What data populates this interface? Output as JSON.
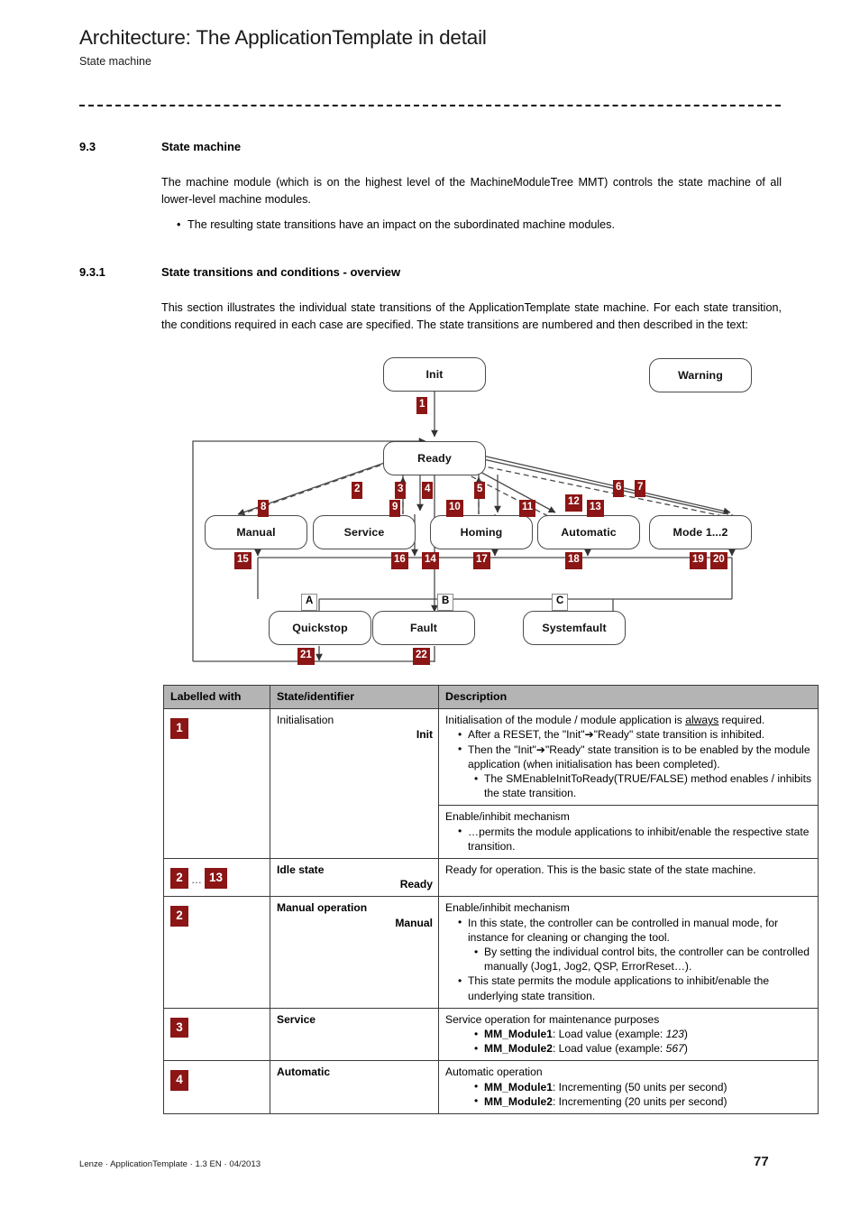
{
  "header": {
    "title": "Architecture: The ApplicationTemplate in detail",
    "subtitle": "State machine"
  },
  "sections": [
    {
      "number": "9.3",
      "title": "State machine",
      "paragraph": "The machine module (which is on the highest level of the MachineModuleTree MMT) controls the state machine of all lower-level machine modules.",
      "bullet": "The resulting state transitions have an impact on the subordinated machine modules."
    },
    {
      "number": "9.3.1",
      "title": "State transitions and conditions - overview",
      "paragraph": "This section illustrates the individual state transitions of the ApplicationTemplate state machine. For each state transition, the conditions required in each case are specified. The state transitions are numbered and then described in the text:"
    }
  ],
  "diagram": {
    "accent_color": "#8c1515",
    "nodes": {
      "init": "Init",
      "warning": "Warning",
      "ready": "Ready",
      "manual": "Manual",
      "service": "Service",
      "homing": "Homing",
      "automatic": "Automatic",
      "mode12": "Mode 1...2",
      "quickstop": "Quickstop",
      "fault": "Fault",
      "systemfault": "Systemfault"
    },
    "transition_tags": [
      "1",
      "2",
      "3",
      "4",
      "5",
      "6",
      "7",
      "8",
      "9",
      "10",
      "11",
      "12",
      "13",
      "14",
      "15",
      "16",
      "17",
      "18",
      "19",
      "20",
      "21",
      "22"
    ],
    "letter_tags": [
      "A",
      "B",
      "C"
    ]
  },
  "table": {
    "headers": [
      "Labelled with",
      "State/identifier",
      "Description"
    ],
    "rows": [
      {
        "tag": "1",
        "state": "Initialisation",
        "identifier": "Init",
        "desc_lead": "Initialisation of the module / module application is always required.",
        "desc_lead_underline": "always",
        "bullets": [
          {
            "level": 1,
            "text": "After a RESET, the \"Init\"➔\"Ready\" state transition is inhibited."
          },
          {
            "level": 1,
            "text": "Then the \"Init\"➔\"Ready\" state transition is to be enabled by the module application (when initialisation has been completed)."
          },
          {
            "level": 2,
            "text": "The SMEnableInitToReady(TRUE/FALSE) method enables / inhibits the state transition."
          }
        ]
      },
      {
        "tag": "",
        "state": "",
        "identifier": "",
        "desc_lead": "Enable/inhibit mechanism",
        "bullets": [
          {
            "level": 1,
            "text": "…permits the module applications to inhibit/enable the respective state transition."
          }
        ]
      },
      {
        "tag": "2",
        "tag2": "13",
        "tag_separator": "…",
        "state": "Idle state",
        "identifier": "Ready",
        "state_bold": true,
        "desc_lead": "Ready for operation. This is the basic state of the state machine.",
        "bullets": []
      },
      {
        "tag": "2",
        "state": "Manual operation",
        "identifier": "Manual",
        "state_bold": true,
        "desc_lead": "Enable/inhibit mechanism",
        "bullets": [
          {
            "level": 1,
            "text": "In this state, the controller can be controlled in manual mode, for instance for cleaning or changing the tool."
          },
          {
            "level": 2,
            "text": "By setting the individual control bits, the controller can be controlled manually (Jog1, Jog2, QSP, ErrorReset…)."
          },
          {
            "level": 1,
            "text": "This state permits the module applications to inhibit/enable the underlying state transition."
          }
        ]
      },
      {
        "tag": "3",
        "state": "Service",
        "identifier": "",
        "state_bold": true,
        "desc_lead": "Service operation for maintenance purposes",
        "bullets": [
          {
            "level": 2,
            "bold": "MM_Module1",
            "text": ": Load value (example: ",
            "italic": "123",
            "tail": ")"
          },
          {
            "level": 2,
            "bold": "MM_Module2",
            "text": ": Load value (example: ",
            "italic": "567",
            "tail": ")"
          }
        ]
      },
      {
        "tag": "4",
        "state": "Automatic",
        "identifier": "",
        "state_bold": true,
        "desc_lead": "Automatic operation",
        "bullets": [
          {
            "level": 2,
            "bold": "MM_Module1",
            "text": ": Incrementing (50 units per second)"
          },
          {
            "level": 2,
            "bold": "MM_Module2",
            "text": ": Incrementing (20 units per second)"
          }
        ]
      }
    ]
  },
  "footer": {
    "left": "Lenze · ApplicationTemplate · 1.3 EN · 04/2013",
    "page": "77"
  }
}
